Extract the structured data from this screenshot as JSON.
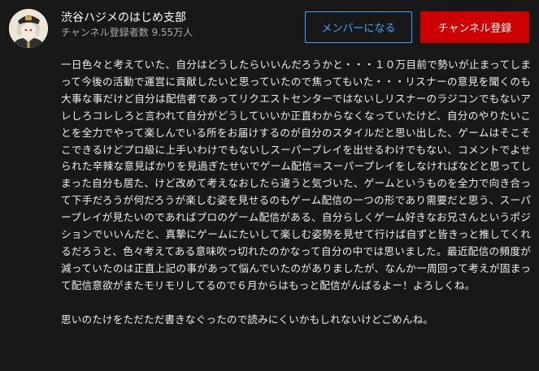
{
  "channel": {
    "name": "渋谷ハジメのはじめ支部",
    "subscribers": "チャンネル登録者数 9.55万人",
    "avatar_icon": "channel-avatar-icon"
  },
  "buttons": {
    "member_label": "メンバーになる",
    "subscribe_label": "チャンネル登録"
  },
  "colors": {
    "background": "#181818",
    "member_accent": "#3ea6ff",
    "subscribe_red": "#cc0000",
    "secondary_text": "#aaaaaa"
  },
  "description": {
    "paragraph_1": "一日色々と考えていた、自分はどうしたらいいんだろうかと・・・１０万目前で勢いが止まってしまって今後の活動で運営に貢献したいと思っていたので焦ってもいた・・・リスナーの意見を聞くのも大事な事だけど自分は配信者であってリクエストセンターではないしリスナーのラジコンでもないアレしろコレしろと言われて自分がどうしていいか正直わからなくなっていたけど、自分のやりたいことを全力でやって楽しんでいる所をお届けするのが自分のスタイルだと思い出した、ゲームはそこそこできるけどプロ級に上手いわけでもないしスーパープレイを出せるわけでもない、コメントでよせられた辛辣な意見ばかりを見過ぎたせいでゲーム配信＝スーパープレイをしなければなどと思ってしまった自分も居た、けど改めて考えなおしたら違うと気づいた、ゲームというものを全力で向き合って下手だろうが何だろうが楽しむ姿を見せるのもゲーム配信の一つの形であり需要だと思う、スーパープレイが見たいのであればプロのゲーム配信がある、自分らしくゲーム好きなお兄さんというポジションでいいんだと、真摯にゲームにたいして楽しむ姿勢を見せて行けば自ずと皆きっと推してくれるだろうと、色々考えてある意味吹っ切れたのかなって自分の中では思いました。最近配信の頻度が減っていたのは正直上記の事があって悩んでいたのがありましたが、なんか一周回って考えが固まって配信意欲がまたモリモリしてるので６月からはもっと配信がんばるよー！よろしくね。",
    "paragraph_2": "思いのたけをただただ書きなぐったので読みにくいかもしれないけどごめんね。"
  }
}
